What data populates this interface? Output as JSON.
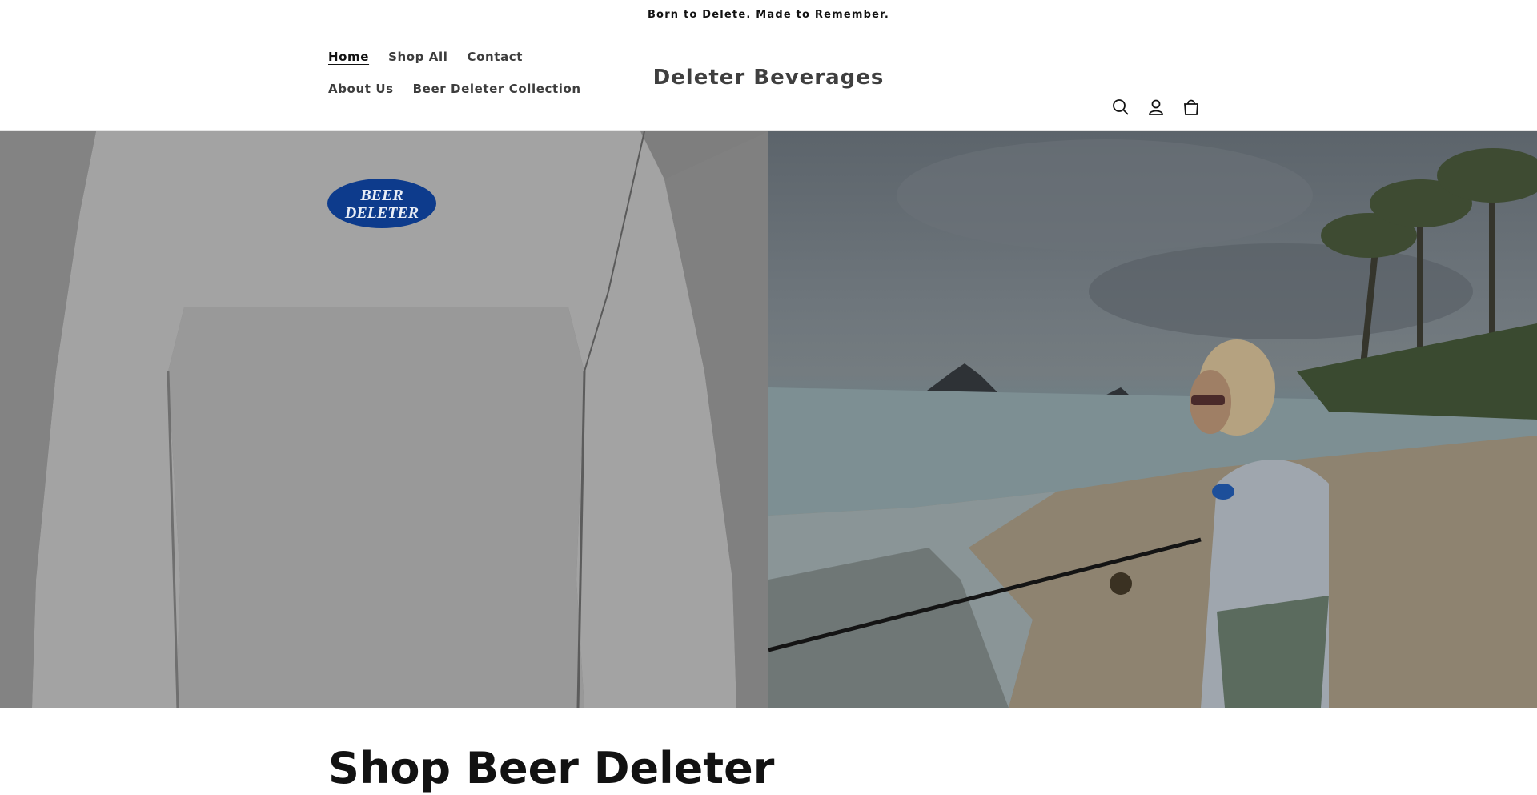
{
  "announcement": {
    "text": "Born to Delete. Made to Remember."
  },
  "header": {
    "nav": [
      {
        "label": "Home",
        "active": true
      },
      {
        "label": "Shop All",
        "active": false
      },
      {
        "label": "Contact",
        "active": false
      },
      {
        "label": "About Us",
        "active": false
      },
      {
        "label": "Beer Deleter Collection",
        "active": false
      }
    ],
    "store_name": "Deleter Beverages",
    "icons": [
      "search-icon",
      "account-icon",
      "cart-icon"
    ]
  },
  "hero": {
    "left_image": {
      "shirt_logo_lines": [
        "BEER",
        "DELETER"
      ],
      "logo_color": "#0d3b8c"
    },
    "right_image": {
      "alt": "beach-fishing-scene"
    }
  },
  "section": {
    "title": "Shop Beer Deleter"
  },
  "colors": {
    "text": "#121212",
    "nav_text": "#3d3d3d",
    "border": "#e6e6e6"
  }
}
